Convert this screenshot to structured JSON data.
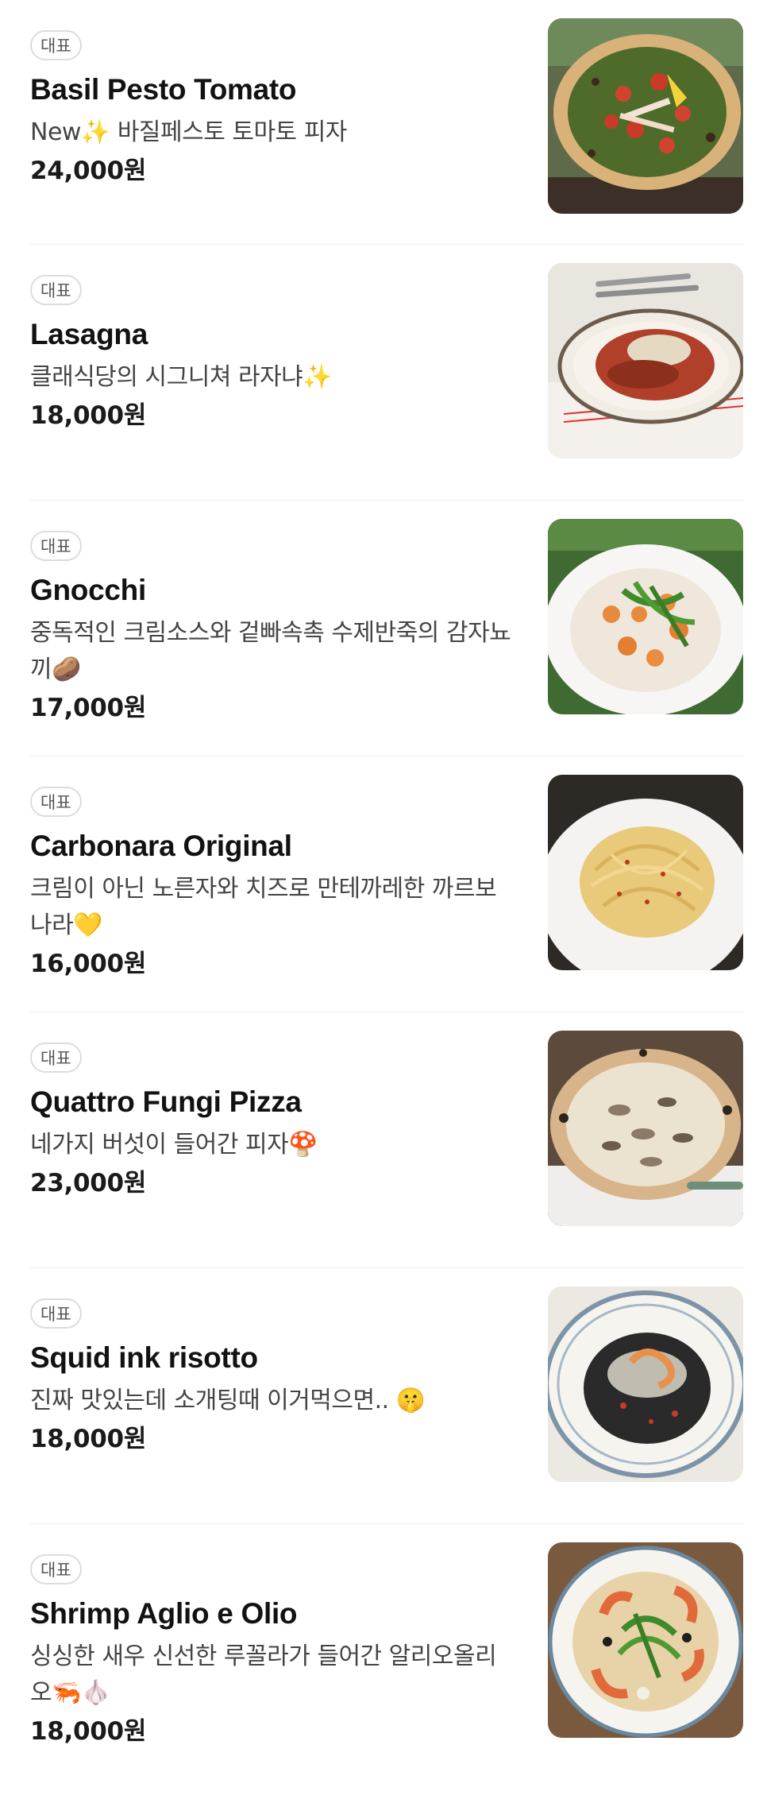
{
  "badge_label": "대표",
  "items": [
    {
      "name": "Basil Pesto Tomato",
      "description": "New✨ 바질페스토 토마토 피자",
      "price": "24,000원",
      "photo": "pizza-basil-pesto-photo"
    },
    {
      "name": "Lasagna",
      "description": "클래식당의 시그니쳐 라자냐✨",
      "price": "18,000원",
      "photo": "lasagna-photo"
    },
    {
      "name": "Gnocchi",
      "description": "중독적인 크림소스와 겉빠속촉 수제반죽의 감자뇨끼🥔",
      "price": "17,000원",
      "photo": "gnocchi-photo"
    },
    {
      "name": "Carbonara Original",
      "description": "크림이 아닌 노른자와 치즈로 만테까레한 까르보나라💛",
      "price": "16,000원",
      "photo": "carbonara-photo"
    },
    {
      "name": "Quattro Fungi Pizza",
      "description": "네가지 버섯이 들어간 피자🍄",
      "price": "23,000원",
      "photo": "mushroom-pizza-photo"
    },
    {
      "name": "Squid ink risotto",
      "description": "진짜 맛있는데 소개팅때 이거먹으면.. 🤫",
      "price": "18,000원",
      "photo": "squid-ink-risotto-photo"
    },
    {
      "name": "Shrimp Aglio e Olio",
      "description": "싱싱한 새우 신선한 루꼴라가 들어간 알리오올리오🦐🧄",
      "price": "18,000원",
      "photo": "shrimp-aglio-photo"
    }
  ]
}
